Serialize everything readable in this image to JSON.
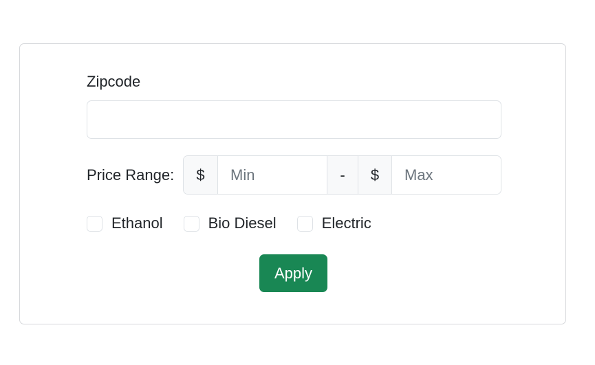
{
  "filter_form": {
    "zipcode_label": "Zipcode",
    "zipcode_value": "",
    "price_label": "Price Range:",
    "currency_symbol_min": "$",
    "min_placeholder": "Min",
    "range_separator": "-",
    "currency_symbol_max": "$",
    "max_placeholder": "Max",
    "fuel_types": [
      {
        "label": "Ethanol",
        "checked": false
      },
      {
        "label": "Bio Diesel",
        "checked": false
      },
      {
        "label": "Electric",
        "checked": false
      }
    ],
    "apply_label": "Apply"
  },
  "colors": {
    "apply_button_bg": "#198754",
    "border": "#dee2e6",
    "addon_bg": "#f8f9fa"
  }
}
